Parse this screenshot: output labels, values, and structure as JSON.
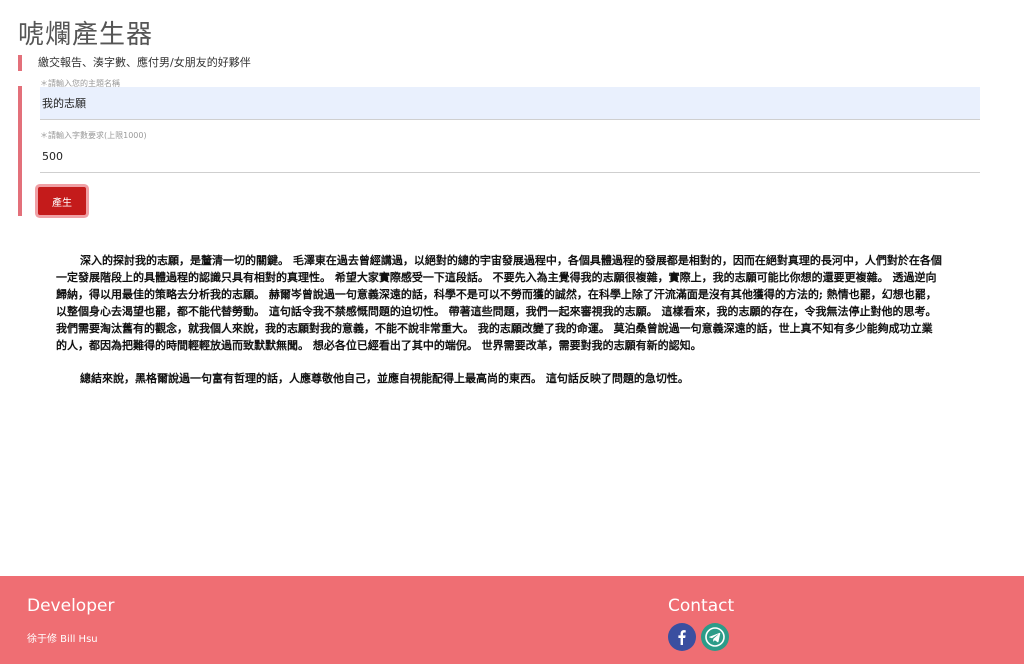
{
  "header": {
    "title": "唬爛產生器",
    "subtitle": "繳交報告、湊字數、應付男/女朋友的好夥伴"
  },
  "form": {
    "topic": {
      "label": "＊請輸入您的主題名稱",
      "value": "我的志願"
    },
    "word_count": {
      "label": "＊請輸入字數要求(上限1000)",
      "value": "500"
    },
    "generate_label": "產生"
  },
  "essay": {
    "paragraphs": [
      "深入的探討我的志願，是釐清一切的關鍵。 毛澤東在過去曾經講過，以絕對的總的宇宙發展過程中，各個具體過程的發展都是相對的，因而在絕對真理的長河中，人們對於在各個一定發展階段上的具體過程的認識只具有相對的真理性。 希望大家實際感受一下這段話。 不要先入為主覺得我的志願很複雜，實際上，我的志願可能比你想的還要更複雜。 透過逆向歸納，得以用最佳的策略去分析我的志願。 赫爾岑曾說過一句意義深遠的話，科學不是可以不勞而獲的誠然，在科學上除了汗流滿面是沒有其他獲得的方法的; 熱情也罷，幻想也罷，以整個身心去渴望也罷，都不能代替勞動。 這句話令我不禁感慨問題的迫切性。 帶著這些問題，我們一起來審視我的志願。 這樣看來，我的志願的存在，令我無法停止對他的思考。 我們需要淘汰舊有的觀念，就我個人來說，我的志願對我的意義，不能不說非常重大。 我的志願改變了我的命運。 莫泊桑曾說過一句意義深遠的話，世上真不知有多少能夠成功立業的人，都因為把難得的時間輕輕放過而致默默無聞。 想必各位已經看出了其中的端倪。 世界需要改革，需要對我的志願有新的認知。",
      "總結來說，黑格爾說過一句富有哲理的話，人應尊敬他自己，並應自視能配得上最高尚的東西。 這句話反映了問題的急切性。"
    ]
  },
  "footer": {
    "developer_heading": "Developer",
    "developer_name": "徐于修 Bill Hsu",
    "contact_heading": "Contact",
    "icons": [
      "facebook-icon",
      "telegram-icon"
    ],
    "colors": {
      "facebook": "#3a4fa0",
      "telegram": "#2c9c89",
      "footer_bg": "#ef6e73",
      "accent": "#c41b1b"
    }
  }
}
